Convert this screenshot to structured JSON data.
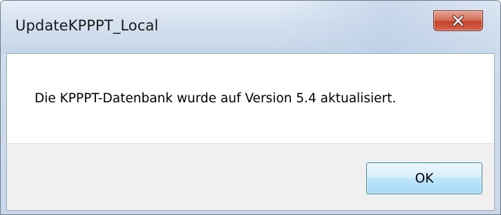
{
  "window": {
    "title": "UpdateKPPPT_Local"
  },
  "titlebar": {
    "close_icon": "close-icon"
  },
  "dialog": {
    "message": "Die KPPPT-Datenbank wurde auf Version 5.4 aktualisiert.",
    "ok_label": "OK"
  },
  "colors": {
    "close_button": "#c4432a",
    "ok_button_border": "#3c7fb1",
    "button_area_bg": "#f0f0f0"
  }
}
